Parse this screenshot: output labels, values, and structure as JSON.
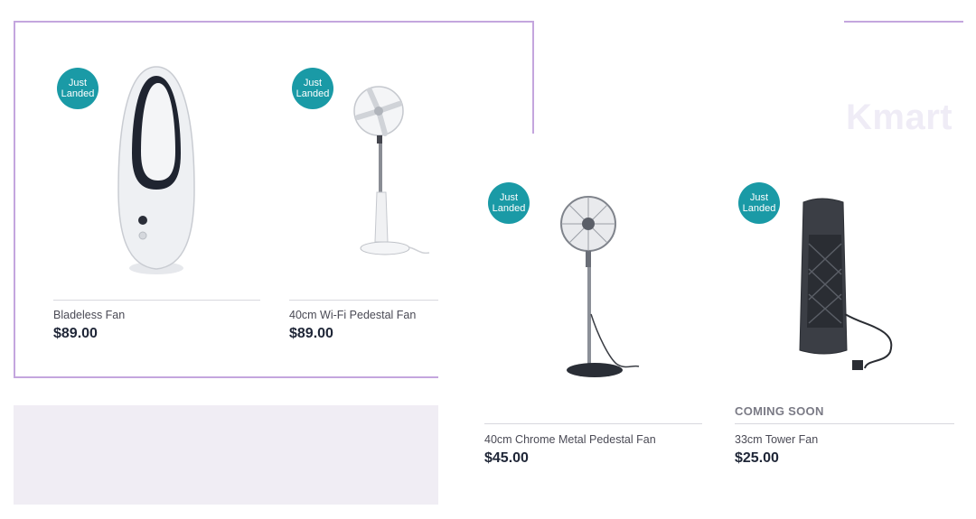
{
  "brand": {
    "name": "Kmart"
  },
  "products": [
    {
      "badge_line1": "Just",
      "badge_line2": "Landed",
      "name": "Bladeless Fan",
      "price": "$89.00"
    },
    {
      "badge_line1": "Just",
      "badge_line2": "Landed",
      "name": "40cm Wi-Fi Pedestal Fan",
      "price": "$89.00"
    },
    {
      "badge_line1": "Just",
      "badge_line2": "Landed",
      "name": "40cm Chrome Metal Pedestal Fan",
      "price": "$45.00"
    },
    {
      "badge_line1": "Just",
      "badge_line2": "Landed",
      "name": "33cm Tower Fan",
      "price": "$25.00",
      "status": "COMING SOON"
    }
  ],
  "colors": {
    "badge": "#1a9aa6",
    "frame_border": "#c4a6de",
    "price_text": "#1f2637"
  },
  "icons": [
    "bladeless-fan-image",
    "wifi-pedestal-fan-image",
    "chrome-pedestal-fan-image",
    "tower-fan-image"
  ]
}
